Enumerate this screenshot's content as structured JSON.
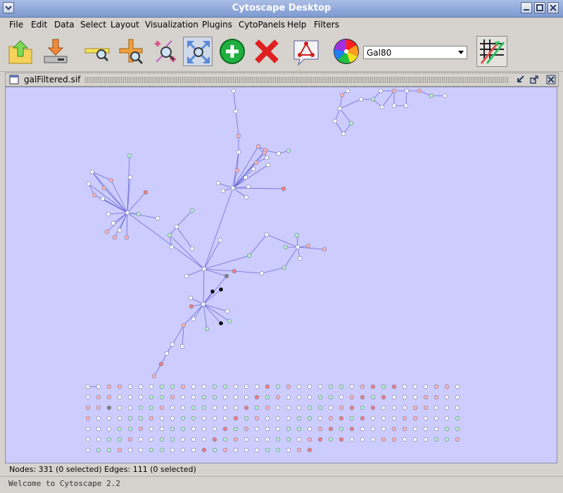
{
  "window": {
    "title": "Cytoscape Desktop"
  },
  "menubar": {
    "items": [
      "File",
      "Edit",
      "Data",
      "Select",
      "Layout",
      "Visualization",
      "Plugins",
      "CytoPanels",
      "Help",
      "Filters"
    ]
  },
  "toolbar": {
    "tools": [
      "open-session-icon",
      "save-session-icon",
      "search-zoom-icon",
      "zoom-in-icon",
      "zoom-selected-icon",
      "fit-content-icon",
      "create-node-icon",
      "delete-icon",
      "new-network-icon",
      "vizmapper-color-wheel-icon",
      "attribute-browser-icon"
    ],
    "attribute_select": {
      "value": "Gal80"
    }
  },
  "network_view": {
    "title": "galFiltered.sif"
  },
  "colors": {
    "canvas_bg": "#ccccff",
    "edge": "#6b6bd6",
    "node_white": "#ffffff",
    "node_pink": "#ffb3b3",
    "node_red": "#f08080",
    "node_green": "#b3f0c8",
    "node_black": "#000000",
    "node_grey": "#808080"
  },
  "status": {
    "counts": "Nodes: 331 (0 selected) Edges: 111 (0 selected)",
    "message": "Welcome to Cytoscape 2.2"
  }
}
